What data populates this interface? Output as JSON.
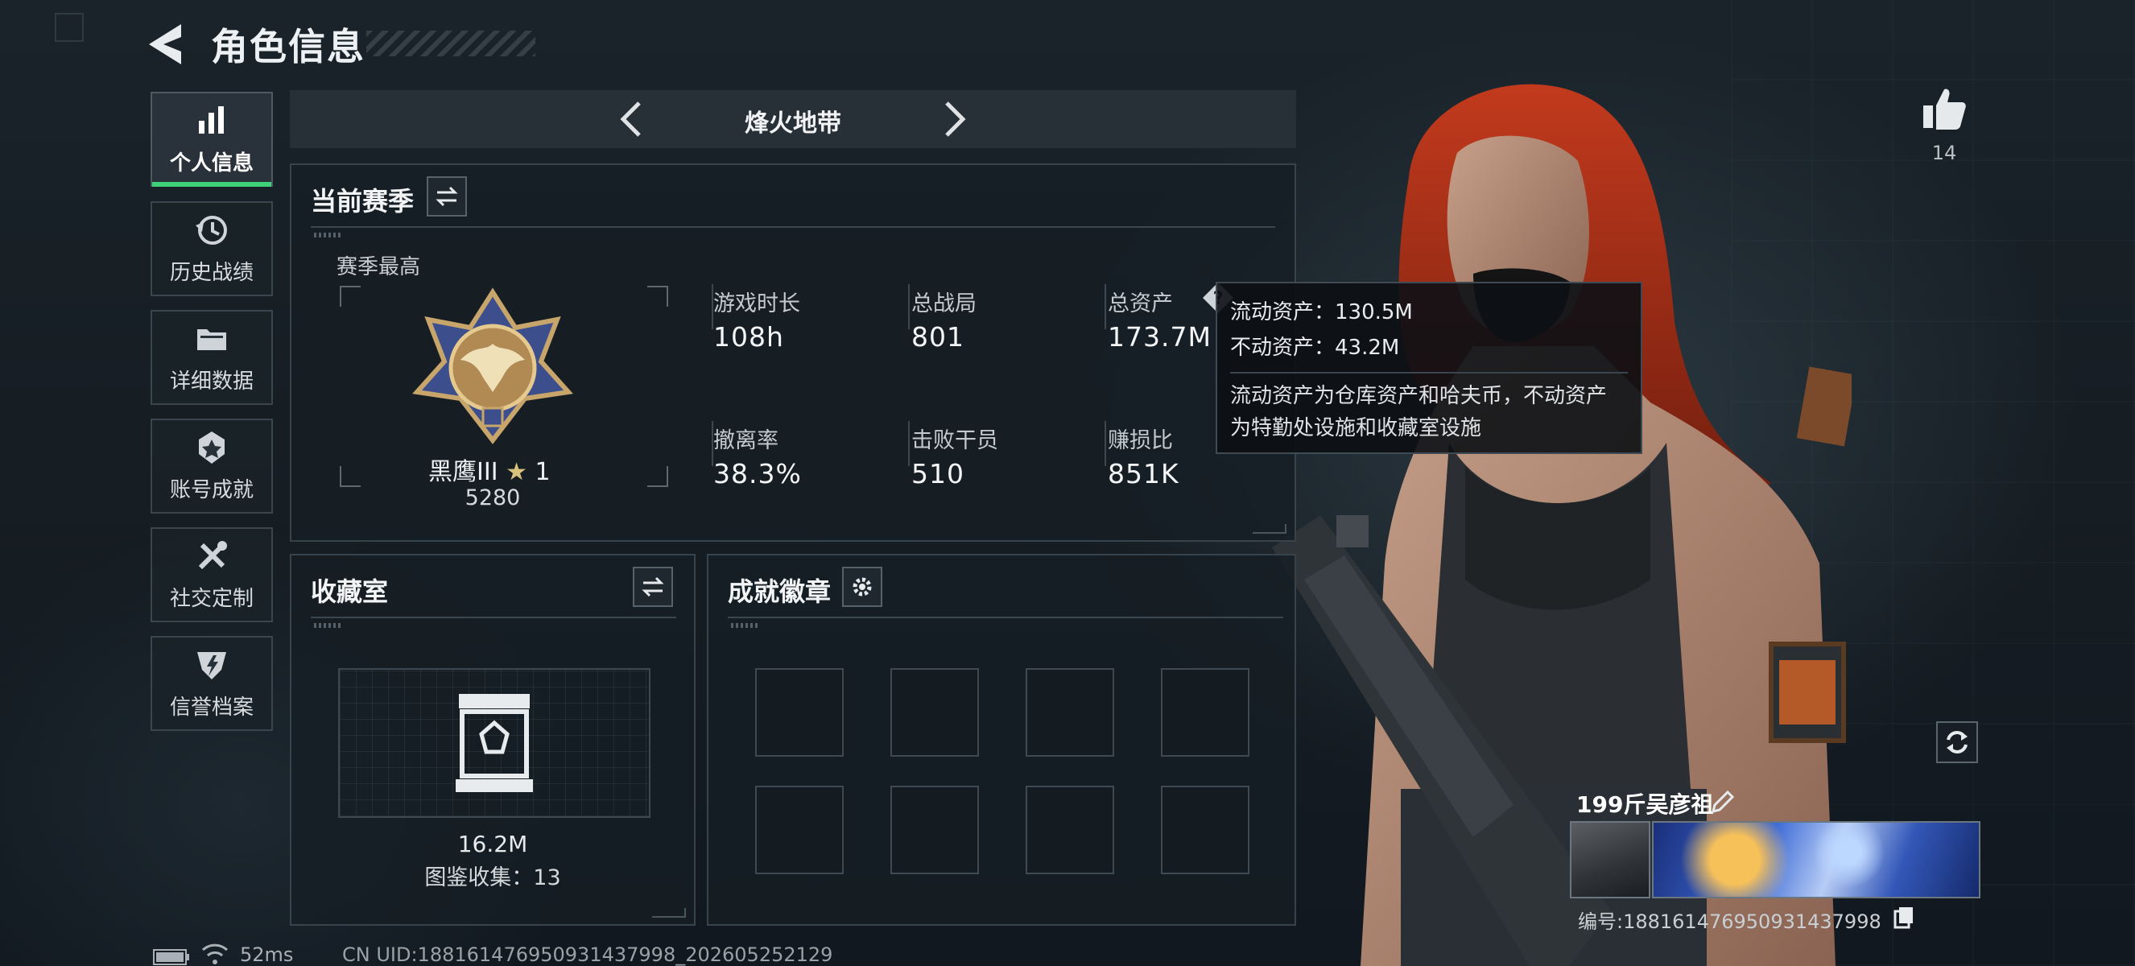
{
  "header": {
    "title": "角色信息"
  },
  "nav": {
    "items": [
      {
        "label": "个人信息",
        "icon": "bar-chart-icon",
        "active": true
      },
      {
        "label": "历史战绩",
        "icon": "history-icon"
      },
      {
        "label": "详细数据",
        "icon": "folder-icon"
      },
      {
        "label": "账号成就",
        "icon": "achievement-icon"
      },
      {
        "label": "社交定制",
        "icon": "tools-icon"
      },
      {
        "label": "信誉档案",
        "icon": "shield-icon"
      }
    ]
  },
  "mode": {
    "title": "烽火地带"
  },
  "season": {
    "title": "当前赛季",
    "peak_label": "赛季最高",
    "rank_name": "黑鹰III",
    "rank_stars": "1",
    "rank_score": "5280",
    "stats": [
      {
        "label": "游戏时长",
        "value": "108h"
      },
      {
        "label": "总战局",
        "value": "801"
      },
      {
        "label": "总资产",
        "value": "173.7M"
      },
      {
        "label": "撤离率",
        "value": "38.3%"
      },
      {
        "label": "击败干员",
        "value": "510"
      },
      {
        "label": "赚损比",
        "value": "851K"
      }
    ]
  },
  "tooltip": {
    "liquid": "流动资产：130.5M",
    "fixed": "不动资产：43.2M",
    "desc_line1": "流动资产为仓库资产和哈夫币，不动资产",
    "desc_line2": "为特勤处设施和收藏室设施"
  },
  "collection": {
    "title": "收藏室",
    "value": "16.2M",
    "count": "图鉴收集：13"
  },
  "achievements": {
    "title": "成就徽章"
  },
  "player": {
    "likes": "14",
    "name": "199斤吴彦祖",
    "uid": "编号:188161476950931437998"
  },
  "status": {
    "ping": "52ms",
    "uid": "CN UID:188161476950931437998_202605252129"
  },
  "colors": {
    "accent": "#3fd17a",
    "panel_border": "#38444d"
  }
}
